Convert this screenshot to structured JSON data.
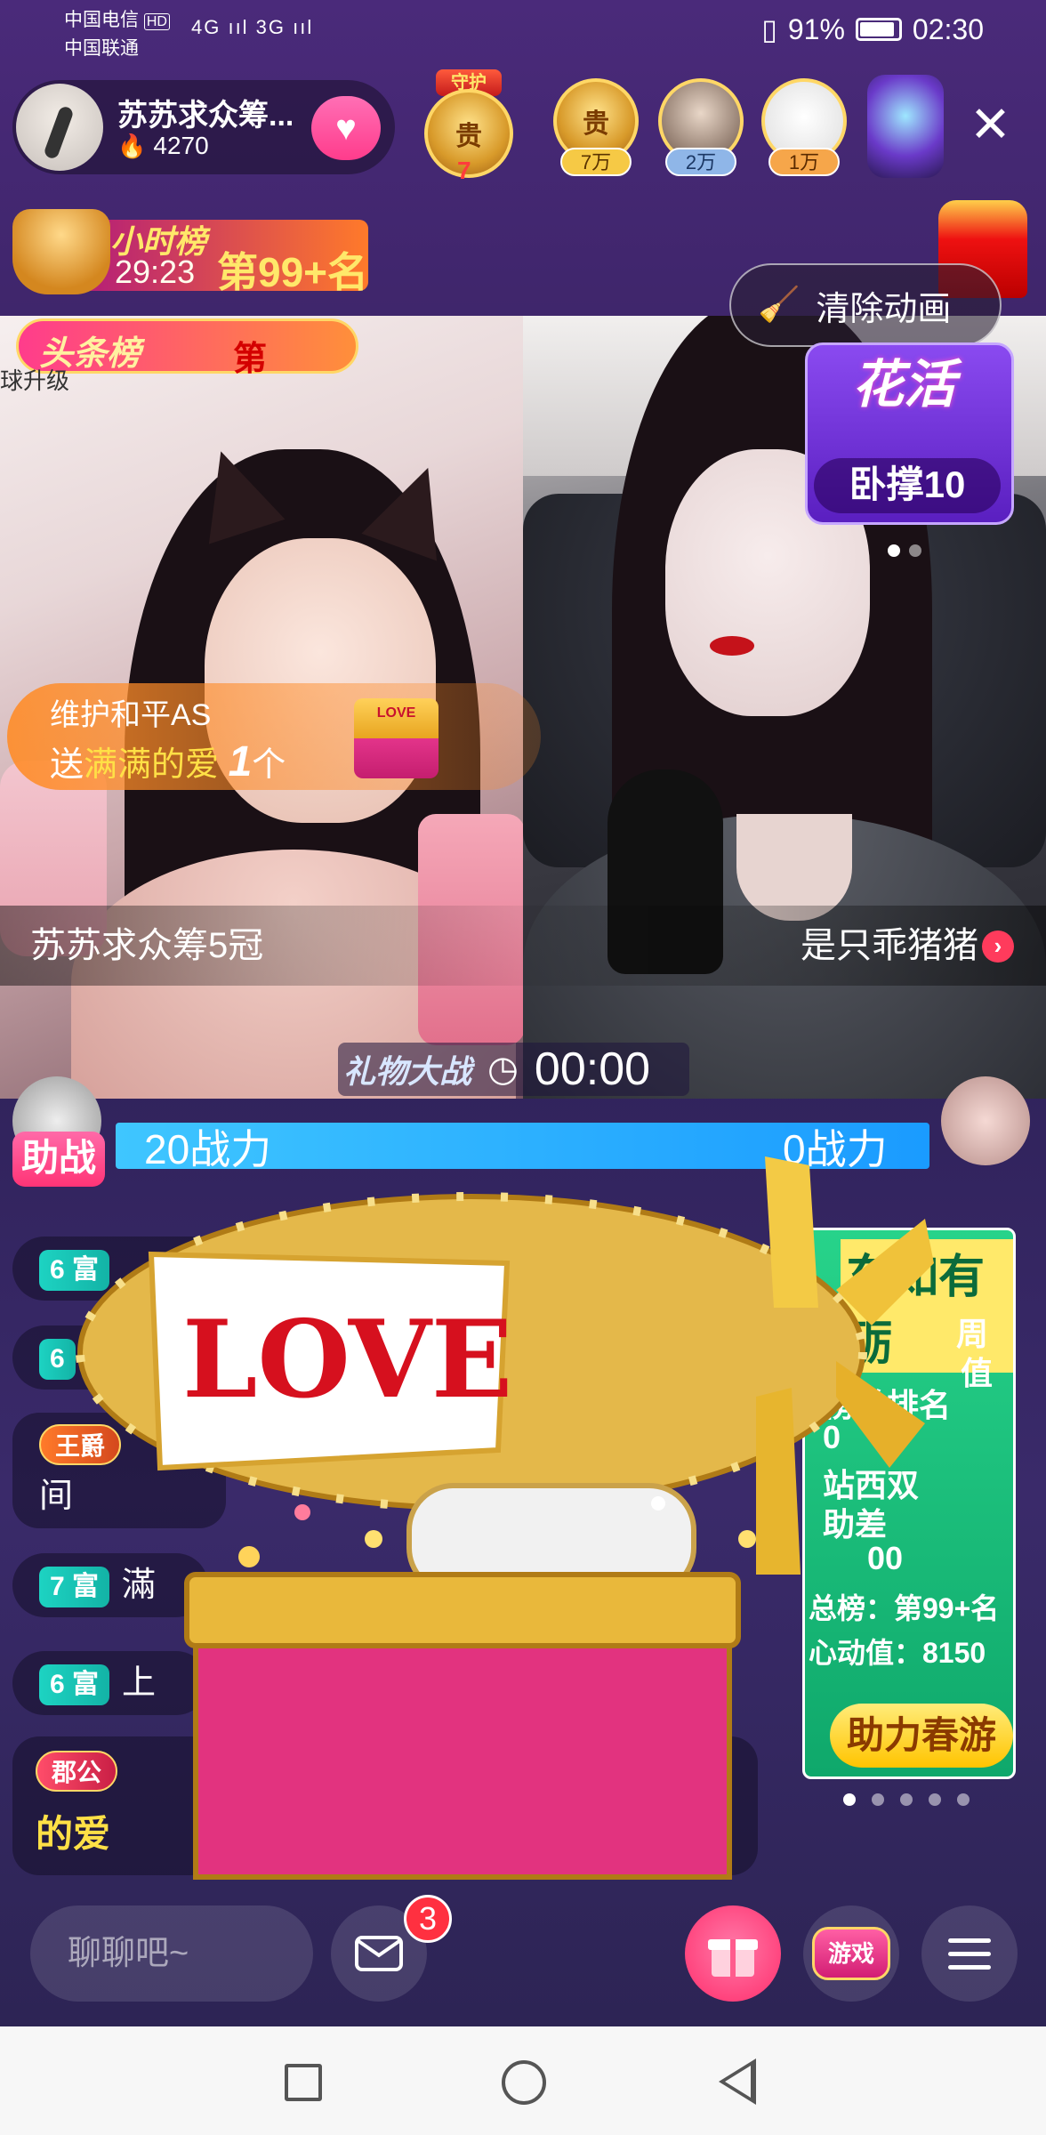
{
  "status_bar": {
    "carrier1": "中国电信",
    "carrier1_tag": "HD",
    "carrier2": "中国联通",
    "signal": "4G ııl 3G ııl",
    "battery": "91%",
    "time": "02:30"
  },
  "host": {
    "name": "苏苏求众筹...",
    "heat": "4270"
  },
  "guard": {
    "label": "守护",
    "rank_char": "贵",
    "level": "7"
  },
  "top_fans": [
    {
      "label": "7万",
      "tag_color": "#f6c945",
      "char": "贵"
    },
    {
      "label": "2万",
      "tag_color": "#8fb6e8"
    },
    {
      "label": "1万",
      "tag_color": "#f6a64a"
    }
  ],
  "hour_rank": {
    "title": "小时榜",
    "countdown": "29:23",
    "rank": "第99+名"
  },
  "clear_animation_label": "清除动画",
  "headline_rank": {
    "title": "头条榜",
    "rank": "第"
  },
  "left_faint_text": "球升级",
  "event_top": {
    "title": "花活",
    "sub": "卧撑10"
  },
  "gift_toast": {
    "user": "维护和平AS",
    "action": "送",
    "gift_name": "满满的爱",
    "count": "1",
    "unit": "个",
    "icon_text": "LOVE"
  },
  "streamers": {
    "left": "苏苏求众筹5冠",
    "right": "是只乖猪猪"
  },
  "battle": {
    "title": "礼物大战",
    "time": "00:00",
    "assist": "助战",
    "left_power": "20战力",
    "right_power": "0战力"
  },
  "chat": [
    {
      "level": "6 富",
      "text": ""
    },
    {
      "level": "6",
      "text": ""
    },
    {
      "badge": "王爵",
      "text": "间"
    },
    {
      "level": "7 富",
      "text": "滿"
    },
    {
      "level": "6 富",
      "text": "上"
    }
  ],
  "chat_big": {
    "badge": "郡公",
    "text": "的爱"
  },
  "event_panel": {
    "title": "东如有砺",
    "lines": [
      "周",
      "值",
      "榜单排名",
      "0",
      "站西双",
      "助差",
      "00",
      "总榜：第99+名",
      "心动值：8150"
    ],
    "button": "助力春游"
  },
  "bottom": {
    "chat_placeholder": "聊聊吧~",
    "msg_count": "3",
    "game_label": "游戏"
  },
  "airship_label": "LOVE"
}
